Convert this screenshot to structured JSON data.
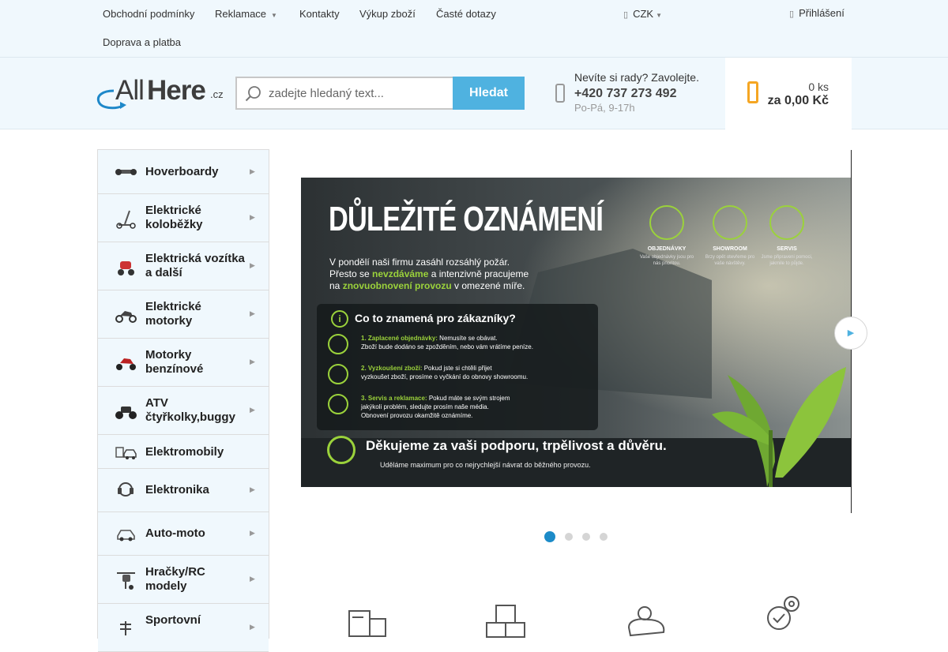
{
  "topnav": {
    "items": [
      {
        "label": "Obchodní podmínky"
      },
      {
        "label": "Reklamace",
        "has_caret": true
      },
      {
        "label": "Kontakty"
      },
      {
        "label": "Výkup zboží"
      },
      {
        "label": "Časté dotazy"
      },
      {
        "label": "Doprava a platba"
      }
    ],
    "caret": "▼",
    "currency": "CZK",
    "login": "Přihlášení"
  },
  "header": {
    "logo": {
      "part1": "All",
      "part2": "Here",
      "suffix": ".cz"
    },
    "search": {
      "placeholder": "zadejte hledaný text...",
      "button": "Hledat"
    },
    "help": {
      "title": "Nevíte si rady? Zavolejte.",
      "phone": "+420 737 273 492",
      "hours": "Po-Pá, 9-17h"
    },
    "cart": {
      "quantity": "0 ks",
      "total": "za 0,00 Kč"
    }
  },
  "sidebar": {
    "categories": [
      {
        "label": "Hoverboardy",
        "icon": "hoverboard-icon"
      },
      {
        "label": "Elektrické koloběžky",
        "icon": "scooter-icon"
      },
      {
        "label": "Elektrická vozítka a další",
        "icon": "vehicle-icon"
      },
      {
        "label": "Elektrické motorky",
        "icon": "e-motorbike-icon"
      },
      {
        "label": "Motorky benzínové",
        "icon": "motorbike-icon"
      },
      {
        "label": "ATV čtyřkolky,buggy",
        "icon": "atv-icon"
      },
      {
        "label": "Elektromobily",
        "icon": "electric-car-icon"
      },
      {
        "label": "Elektronika",
        "icon": "electronics-icon"
      },
      {
        "label": "Auto-moto",
        "icon": "car-icon"
      },
      {
        "label": "Hračky/RC modely",
        "icon": "rc-toy-icon"
      },
      {
        "label": "Sportovní",
        "icon": "sport-icon"
      }
    ],
    "expand_glyph": "▶"
  },
  "banner": {
    "title": "DŮLEŽITÉ OZNÁMENÍ",
    "intro_1": "V pondělí naši firmu zasáhl rozsáhlý požár.",
    "intro_2a": "Přesto se ",
    "intro_2b": "nevzdáváme",
    "intro_2c": " a intenzivně pracujeme",
    "intro_3a": "na ",
    "intro_3b": "znovuobnovení provozu",
    "intro_3c": " v omezené míře.",
    "features": [
      {
        "title": "OBJEDNÁVKY",
        "desc": "Vaše objednávky jsou pro nás prioritou."
      },
      {
        "title": "SHOWROOM",
        "desc": "Brzy opět otevřeme pro vaše návštěvy."
      },
      {
        "title": "SERVIS",
        "desc": "Jsme připraveni pomoci, jakmile to půjde."
      }
    ],
    "box_title": "Co to znamená pro zákazníky?",
    "items": [
      {
        "head": "1. Zaplacené objednávky:",
        "text": " Nemusíte se obávat.",
        "line2": "Zboží bude dodáno se zpožděním, nebo vám vrátíme peníze."
      },
      {
        "head": "2. Vyzkoušení zboží:",
        "text": " Pokud jste si chtěli přijet",
        "line2": "vyzkoušet zboží, prosíme o vyčkání do obnovy showroomu."
      },
      {
        "head": "3. Servis a reklamace:",
        "text": " Pokud máte se svým strojem",
        "line2": "jakýkoli problém, sledujte prosím naše média.",
        "line3": "Obnovení provozu okamžitě oznámíme."
      }
    ],
    "thanks": "Děkujeme za vaši podporu, trpělivost a důvěru.",
    "footer": "Uděláme maximum pro co nejrychlejší návrat do běžného provozu."
  },
  "slider": {
    "total_slides": 4,
    "active_slide": 1,
    "next_glyph": "▶"
  },
  "benefits": [
    {
      "icon": "delivery-truck-icon"
    },
    {
      "icon": "boxes-icon"
    },
    {
      "icon": "piggy-bank-icon"
    },
    {
      "icon": "service-gear-icon"
    }
  ],
  "colors": {
    "accent": "#4fb2e0",
    "header_bg": "#f0f8fd",
    "cart_icon": "#f5a623",
    "banner_highlight": "#9bd23b",
    "active_dot": "#1c8bc8"
  }
}
